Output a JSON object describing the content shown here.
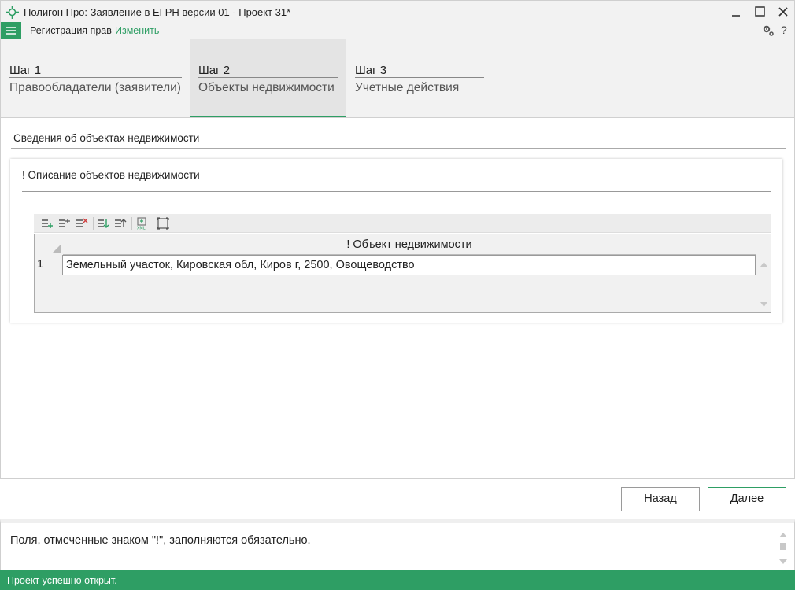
{
  "window": {
    "title": "Полигон Про: Заявление в ЕГРН версии 01 - Проект 31*"
  },
  "menubar": {
    "registration_label": "Регистрация прав",
    "change_link": "Изменить",
    "help_label": "?"
  },
  "steps": [
    {
      "number": "Шаг 1",
      "name": "Правообладатели (заявители)",
      "active": false
    },
    {
      "number": "Шаг 2",
      "name": "Объекты недвижимости",
      "active": true
    },
    {
      "number": "Шаг 3",
      "name": "Учетные действия",
      "active": false
    }
  ],
  "main": {
    "section_title": "Сведения об объектах недвижимости",
    "card_title": "! Описание объектов недвижимости",
    "grid": {
      "column_header": "! Объект недвижимости",
      "rows": [
        {
          "num": "1",
          "value": "Земельный участок, Кировская обл, Киров г, 2500, Овощеводство"
        }
      ]
    }
  },
  "buttons": {
    "back": "Назад",
    "next": "Далее"
  },
  "info": {
    "text": "Поля, отмеченные знаком \"!\", заполняются обязательно."
  },
  "status": {
    "text": "Проект успешно открыт."
  },
  "colors": {
    "accent": "#2e9e64"
  }
}
